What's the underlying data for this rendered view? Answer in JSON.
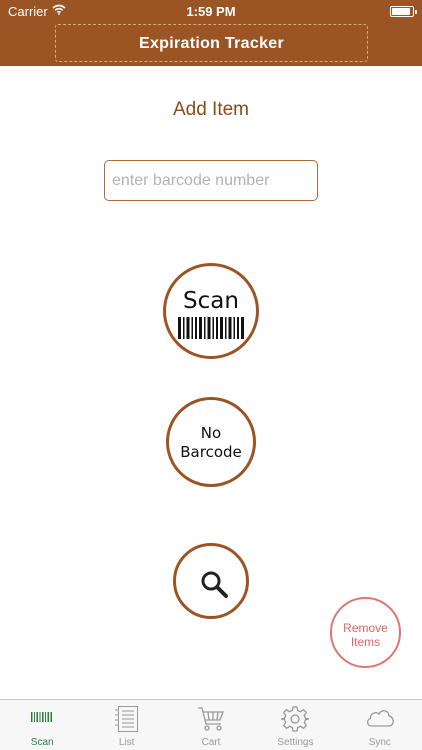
{
  "status_bar": {
    "carrier": "Carrier",
    "time": "1:59 PM",
    "battery_level": 0.9
  },
  "header": {
    "title": "Expiration Tracker"
  },
  "main": {
    "heading": "Add Item",
    "barcode_input": {
      "placeholder": "enter barcode number",
      "value": ""
    },
    "scan_button": {
      "label": "Scan",
      "icon": "barcode-icon"
    },
    "no_barcode_button": {
      "label_line1": "No",
      "label_line2": "Barcode"
    },
    "search_button": {
      "icon": "magnifier-icon"
    },
    "remove_items_button": {
      "label_line1": "Remove",
      "label_line2": "Items"
    }
  },
  "tab_bar": {
    "active": "Scan",
    "tabs": [
      {
        "label": "Scan",
        "icon": "barcode-icon"
      },
      {
        "label": "List",
        "icon": "list-document-icon"
      },
      {
        "label": "Cart",
        "icon": "shopping-cart-icon"
      },
      {
        "label": "Settings",
        "icon": "gear-icon"
      },
      {
        "label": "Sync",
        "icon": "cloud-icon"
      }
    ]
  },
  "colors": {
    "header_brown": "#9b5524",
    "heading_brown": "#8b4a17",
    "remove_red": "#e2645d",
    "active_tab_green": "#2d7a48",
    "inactive_tab_gray": "#9a9a9a"
  }
}
